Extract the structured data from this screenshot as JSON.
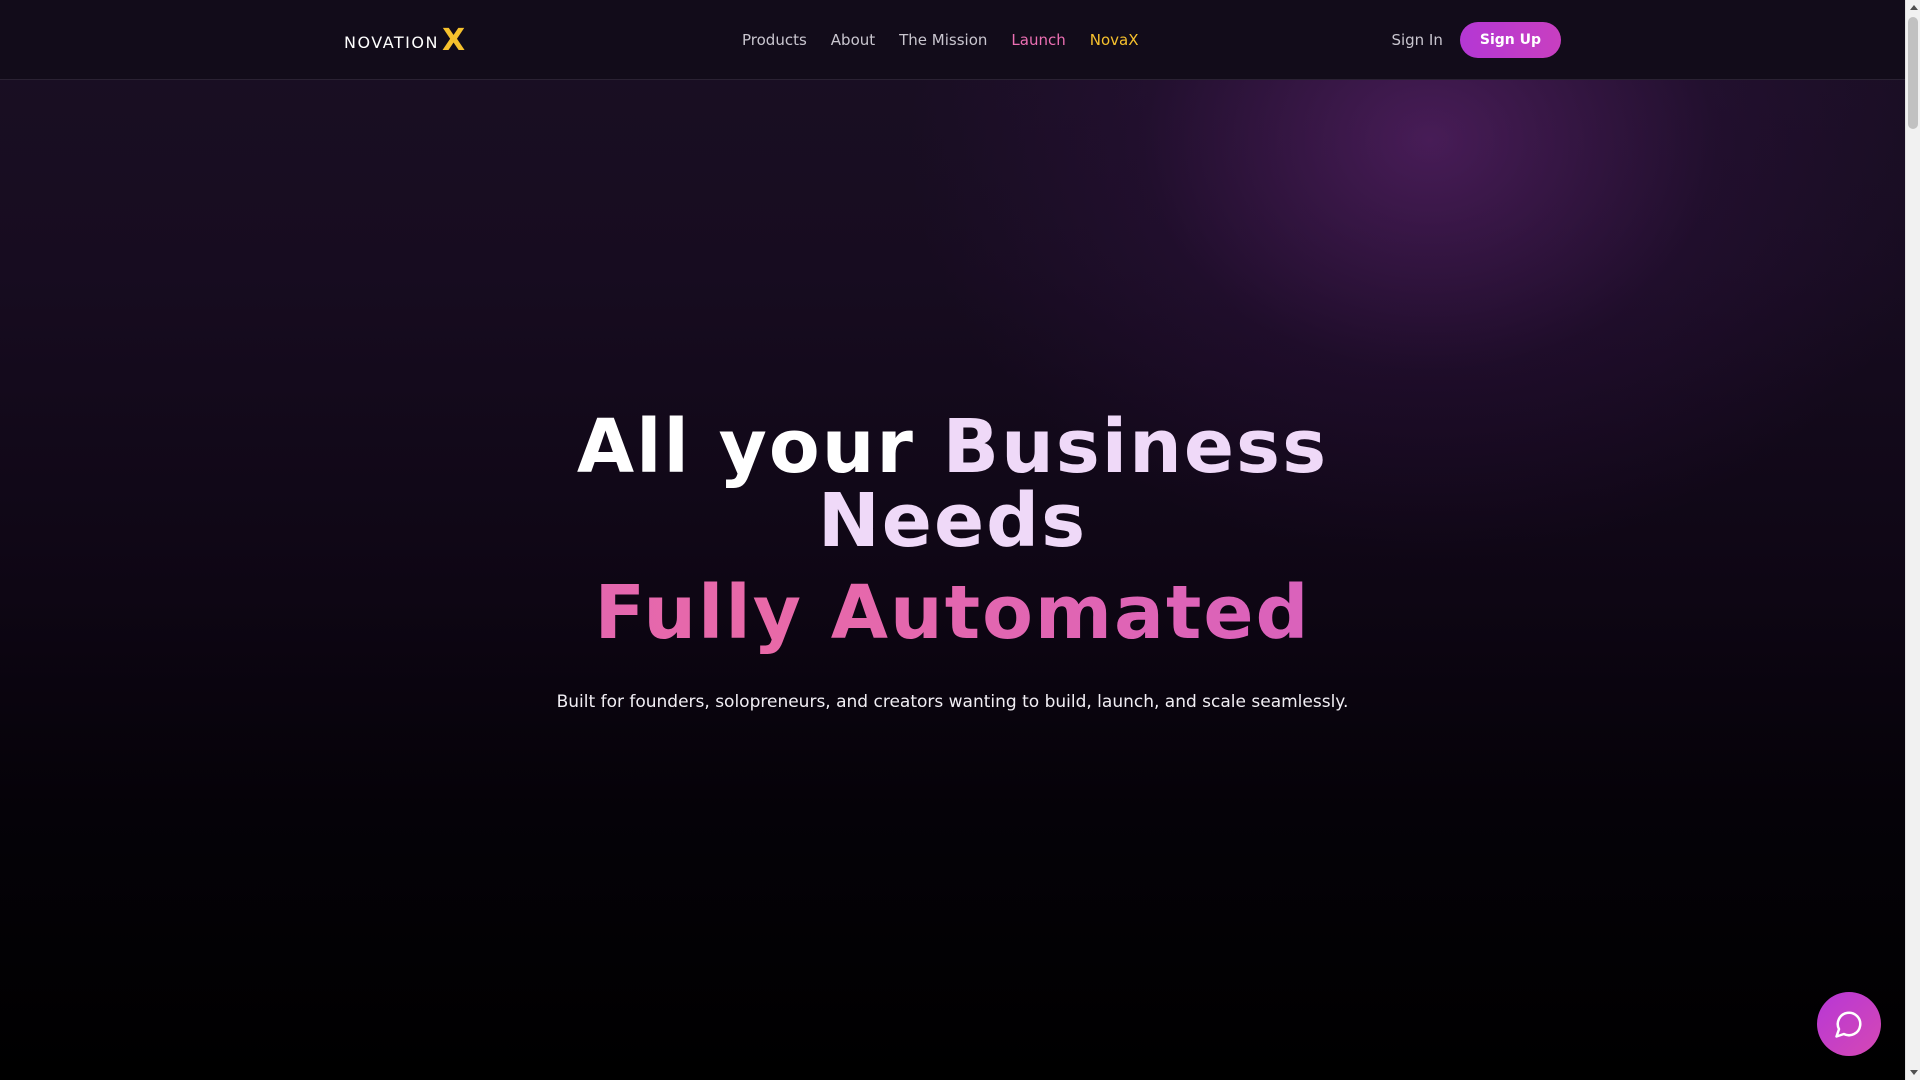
{
  "brand": {
    "name_text": "NOVATION",
    "name_x": "X",
    "accent_yellow": "#f6c12d",
    "accent_pink": "#ec6fb3",
    "accent_purple": "#b437d4"
  },
  "nav": {
    "links": [
      {
        "label": "Products"
      },
      {
        "label": "About"
      },
      {
        "label": "The Mission"
      },
      {
        "label": "Launch"
      },
      {
        "label": "NovaX"
      }
    ],
    "sign_in": "Sign In",
    "sign_up": "Sign Up"
  },
  "hero": {
    "title_words": [
      "All",
      "your",
      "Business",
      "Needs"
    ],
    "subtitle": "Fully Automated",
    "description": "Built for founders, solopreneurs, and creators wanting to build, launch, and scale seamlessly."
  },
  "chat": {
    "icon": "chat-bubble-icon"
  }
}
